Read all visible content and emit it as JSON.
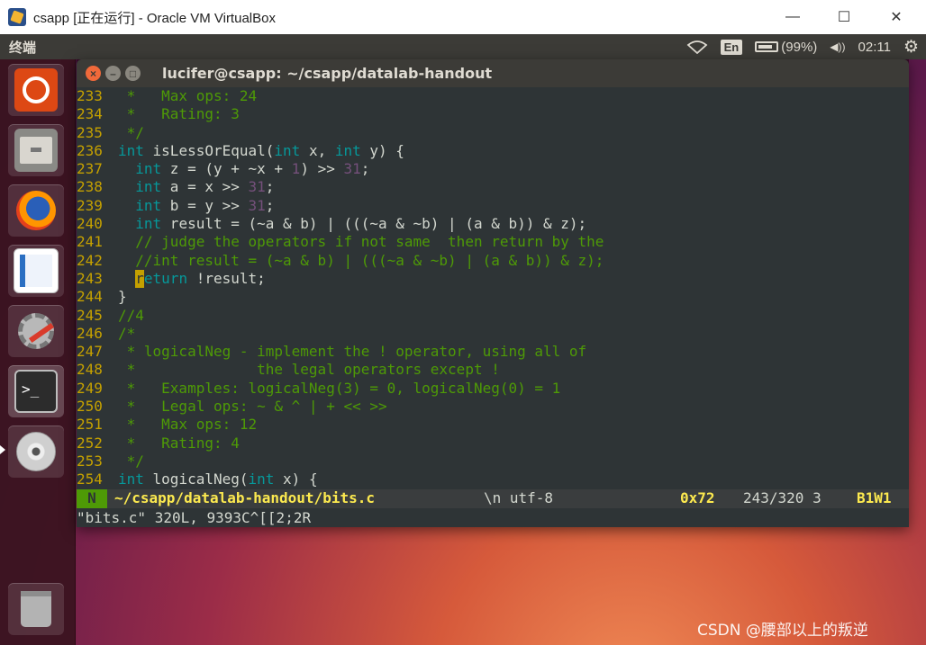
{
  "host_window": {
    "title": "csapp [正在运行] - Oracle VM VirtualBox",
    "minimize_glyph": "—",
    "maximize_glyph": "☐",
    "close_glyph": "✕"
  },
  "ubuntu_panel": {
    "title": "终端",
    "wifi_icon": "wifi-icon",
    "lang": "En",
    "battery_text": "(99%)",
    "volume_glyph": "◀))",
    "time": "02:11",
    "gear_glyph": "⚙"
  },
  "launcher": {
    "items": [
      "ubuntu-home-icon",
      "files-icon",
      "firefox-icon",
      "writer-icon",
      "system-settings-icon",
      "terminal-icon",
      "dvd-icon",
      "trash-icon"
    ],
    "terminal_prompt": ">_"
  },
  "terminal": {
    "title": "lucifer@csapp: ~/csapp/datalab-handout",
    "close_glyph": "×",
    "min_glyph": "–",
    "max_glyph": "□",
    "lines": [
      {
        "num": "233",
        "segs": [
          {
            "t": " *   Max ops: 24",
            "c": "c"
          }
        ]
      },
      {
        "num": "234",
        "segs": [
          {
            "t": " *   Rating: 3",
            "c": "c"
          }
        ]
      },
      {
        "num": "235",
        "segs": [
          {
            "t": " */",
            "c": "c"
          }
        ]
      },
      {
        "num": "236",
        "segs": [
          {
            "t": "int",
            "c": "k"
          },
          {
            "t": " isLessOrEqual(",
            "c": "p"
          },
          {
            "t": "int",
            "c": "k"
          },
          {
            "t": " x, ",
            "c": "p"
          },
          {
            "t": "int",
            "c": "k"
          },
          {
            "t": " y) {",
            "c": "p"
          }
        ]
      },
      {
        "num": "237",
        "segs": [
          {
            "t": "  ",
            "c": "p"
          },
          {
            "t": "int",
            "c": "k"
          },
          {
            "t": " z = (y + ~x + ",
            "c": "p"
          },
          {
            "t": "1",
            "c": "n"
          },
          {
            "t": ") >> ",
            "c": "p"
          },
          {
            "t": "31",
            "c": "n"
          },
          {
            "t": ";",
            "c": "p"
          }
        ]
      },
      {
        "num": "238",
        "segs": [
          {
            "t": "  ",
            "c": "p"
          },
          {
            "t": "int",
            "c": "k"
          },
          {
            "t": " a = x >> ",
            "c": "p"
          },
          {
            "t": "31",
            "c": "n"
          },
          {
            "t": ";",
            "c": "p"
          }
        ]
      },
      {
        "num": "239",
        "segs": [
          {
            "t": "  ",
            "c": "p"
          },
          {
            "t": "int",
            "c": "k"
          },
          {
            "t": " b = y >> ",
            "c": "p"
          },
          {
            "t": "31",
            "c": "n"
          },
          {
            "t": ";",
            "c": "p"
          }
        ]
      },
      {
        "num": "240",
        "segs": [
          {
            "t": "  ",
            "c": "p"
          },
          {
            "t": "int",
            "c": "k"
          },
          {
            "t": " result = (~a & b) | (((~a & ~b) | (a & b)) & z);",
            "c": "p"
          }
        ]
      },
      {
        "num": "241",
        "segs": [
          {
            "t": "  // judge the operators if not same  then return by the",
            "c": "c"
          }
        ]
      },
      {
        "num": "242",
        "segs": [
          {
            "t": "  //int result = (~a & b) | (((~a & ~b) | (a & b)) & z);",
            "c": "c"
          }
        ]
      },
      {
        "num": "243",
        "segs": [
          {
            "t": "  ",
            "c": "p"
          },
          {
            "t": "r",
            "c": "cur"
          },
          {
            "t": "eturn",
            "c": "k"
          },
          {
            "t": " !result;",
            "c": "p"
          }
        ]
      },
      {
        "num": "244",
        "segs": [
          {
            "t": "}",
            "c": "p"
          }
        ]
      },
      {
        "num": "245",
        "segs": [
          {
            "t": "//4",
            "c": "c"
          }
        ]
      },
      {
        "num": "246",
        "segs": [
          {
            "t": "/*",
            "c": "c"
          }
        ]
      },
      {
        "num": "247",
        "segs": [
          {
            "t": " * logicalNeg - implement the ! operator, using all of",
            "c": "c"
          }
        ]
      },
      {
        "num": "248",
        "segs": [
          {
            "t": " *              the legal operators except !",
            "c": "c"
          }
        ]
      },
      {
        "num": "249",
        "segs": [
          {
            "t": " *   Examples: logicalNeg(3) = 0, logicalNeg(0) = 1",
            "c": "c"
          }
        ]
      },
      {
        "num": "250",
        "segs": [
          {
            "t": " *   Legal ops: ~ & ^ | + << >>",
            "c": "c"
          }
        ]
      },
      {
        "num": "251",
        "segs": [
          {
            "t": " *   Max ops: 12",
            "c": "c"
          }
        ]
      },
      {
        "num": "252",
        "segs": [
          {
            "t": " *   Rating: 4",
            "c": "c"
          }
        ]
      },
      {
        "num": "253",
        "segs": [
          {
            "t": " */",
            "c": "c"
          }
        ]
      },
      {
        "num": "254",
        "segs": [
          {
            "t": "int",
            "c": "k"
          },
          {
            "t": " logicalNeg(",
            "c": "p"
          },
          {
            "t": "int",
            "c": "k"
          },
          {
            "t": " x) {",
            "c": "p"
          }
        ]
      }
    ],
    "status": {
      "mode": "N",
      "file": "~/csapp/datalab-handout/bits.c",
      "encoding": "\\n utf-8",
      "hex": "0x72",
      "position": "243/320 3",
      "buffer": "B1W1"
    },
    "command_line": "\"bits.c\" 320L, 9393C^[[2;2R"
  },
  "watermark": "CSDN @腰部以上的叛逆",
  "colors": {
    "comment": "#4e9a06",
    "keyword": "#06989a",
    "number": "#75507b",
    "line_number": "#c4a000",
    "terminal_bg": "#2e3436"
  }
}
